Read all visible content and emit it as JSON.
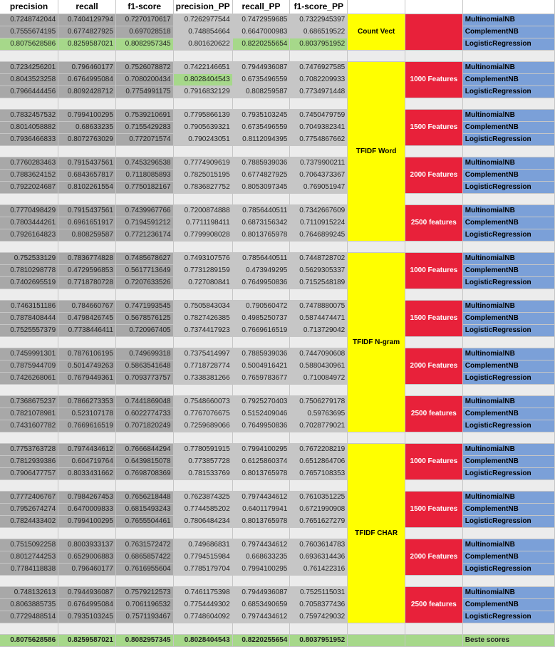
{
  "columns": [
    "precision",
    "recall",
    "f1-score",
    "precision_PP",
    "recall_PP",
    "f1-score_PP"
  ],
  "models": [
    "MultinomialNB",
    "ComplementNB",
    "LogisticRegression"
  ],
  "groups": [
    {
      "section": "Count Vect",
      "label": "",
      "rows": [
        [
          "0.7248742044",
          "0.7404129794",
          "0.7270170617",
          "0.7262977544",
          "0.7472959685",
          "0.7322945397"
        ],
        [
          "0.7555674195",
          "0.6774827925",
          "0.697028518",
          "0.748854664",
          "0.6647000983",
          "0.686519522"
        ],
        [
          "0.8075628586",
          "0.8259587021",
          "0.8082957345",
          "0.801620622",
          "0.8220255654",
          "0.8037951952"
        ]
      ]
    },
    {
      "section": "TFIDF Word",
      "label": "1000 Features",
      "rows": [
        [
          "0.7234256201",
          "0.796460177",
          "0.7526078872",
          "0.7422146651",
          "0.7944936087",
          "0.7476927585"
        ],
        [
          "0.8043523258",
          "0.6764995084",
          "0.7080200434",
          "0.8028404543",
          "0.6735496559",
          "0.7082209933"
        ],
        [
          "0.7966444456",
          "0.8092428712",
          "0.7754991175",
          "0.7916832129",
          "0.808259587",
          "0.7734971448"
        ]
      ]
    },
    {
      "section": "TFIDF Word",
      "label": "1500 Features",
      "rows": [
        [
          "0.7832457532",
          "0.7994100295",
          "0.7539210691",
          "0.7795866139",
          "0.7935103245",
          "0.7450479759"
        ],
        [
          "0.8014058882",
          "0.68633235",
          "0.7155429283",
          "0.7905639321",
          "0.6735496559",
          "0.7049382341"
        ],
        [
          "0.7936466833",
          "0.8072763029",
          "0.772071574",
          "0.790243051",
          "0.8112094395",
          "0.7754867662"
        ]
      ]
    },
    {
      "section": "TFIDF Word",
      "label": "2000 Features",
      "rows": [
        [
          "0.7760283463",
          "0.7915437561",
          "0.7453296538",
          "0.7774909619",
          "0.7885939036",
          "0.7379900211"
        ],
        [
          "0.7883624152",
          "0.6843657817",
          "0.7118085893",
          "0.7825015195",
          "0.6774827925",
          "0.7064373367"
        ],
        [
          "0.7922024687",
          "0.8102261554",
          "0.7750182167",
          "0.7836827752",
          "0.8053097345",
          "0.769051947"
        ]
      ]
    },
    {
      "section": "TFIDF Word",
      "label": "2500 features",
      "rows": [
        [
          "0.7770498429",
          "0.7915437561",
          "0.7439967766",
          "0.7200874888",
          "0.7856440511",
          "0.7342667609"
        ],
        [
          "0.7803444261",
          "0.6961651917",
          "0.7194591212",
          "0.7711198411",
          "0.6873156342",
          "0.7110915224"
        ],
        [
          "0.7926164823",
          "0.808259587",
          "0.7721236174",
          "0.7799908028",
          "0.8013765978",
          "0.7646899245"
        ]
      ]
    },
    {
      "section": "TFIDF N-gram",
      "label": "1000 Features",
      "rows": [
        [
          "0.752533129",
          "0.7836774828",
          "0.7485678627",
          "0.7493107576",
          "0.7856440511",
          "0.7448728702"
        ],
        [
          "0.7810298778",
          "0.4729596853",
          "0.5617713649",
          "0.7731289159",
          "0.473949295",
          "0.5629305337"
        ],
        [
          "0.7402695519",
          "0.7718780728",
          "0.7207633526",
          "0.727080841",
          "0.7649950836",
          "0.7152548189"
        ]
      ]
    },
    {
      "section": "TFIDF N-gram",
      "label": "1500 Features",
      "rows": [
        [
          "0.7463151186",
          "0.784660767",
          "0.7471993545",
          "0.7505843034",
          "0.790560472",
          "0.7478880075"
        ],
        [
          "0.7878408444",
          "0.4798426745",
          "0.5678576125",
          "0.7827426385",
          "0.4985250737",
          "0.5874474471"
        ],
        [
          "0.7525557379",
          "0.7738446411",
          "0.720967405",
          "0.7374417923",
          "0.7669616519",
          "0.713729042"
        ]
      ]
    },
    {
      "section": "TFIDF N-gram",
      "label": "2000 Features",
      "rows": [
        [
          "0.7459991301",
          "0.7876106195",
          "0.749699318",
          "0.7375414997",
          "0.7885939036",
          "0.7447090608"
        ],
        [
          "0.7875944709",
          "0.5014749263",
          "0.5863541648",
          "0.7718728774",
          "0.5004916421",
          "0.5880430961"
        ],
        [
          "0.7426268061",
          "0.7679449361",
          "0.7093773757",
          "0.7338381266",
          "0.7659783677",
          "0.710084972"
        ]
      ]
    },
    {
      "section": "TFIDF N-gram",
      "label": "2500 features",
      "rows": [
        [
          "0.7368675237",
          "0.7866273353",
          "0.7441869048",
          "0.7548660073",
          "0.7925270403",
          "0.7506279178"
        ],
        [
          "0.7821078981",
          "0.523107178",
          "0.6022774733",
          "0.7767076675",
          "0.5152409046",
          "0.59763695"
        ],
        [
          "0.7431607782",
          "0.7669616519",
          "0.7071820249",
          "0.7259689066",
          "0.7649950836",
          "0.7028779021"
        ]
      ]
    },
    {
      "section": "TFIDF CHAR",
      "label": "1000 Features",
      "rows": [
        [
          "0.7753763728",
          "0.7974434612",
          "0.7666844294",
          "0.7780591915",
          "0.7994100295",
          "0.7672208219"
        ],
        [
          "0.7812939386",
          "0.604719764",
          "0.6439815078",
          "0.773857728",
          "0.6125860374",
          "0.6512864706"
        ],
        [
          "0.7906477757",
          "0.8033431662",
          "0.7698708369",
          "0.781533769",
          "0.8013765978",
          "0.7657108353"
        ]
      ]
    },
    {
      "section": "TFIDF CHAR",
      "label": "1500 Features",
      "rows": [
        [
          "0.7772406767",
          "0.7984267453",
          "0.7656218448",
          "0.7623874325",
          "0.7974434612",
          "0.7610351225"
        ],
        [
          "0.7952674274",
          "0.6470009833",
          "0.6815493243",
          "0.7744585202",
          "0.6401179941",
          "0.6721990908"
        ],
        [
          "0.7824433402",
          "0.7994100295",
          "0.7655504461",
          "0.7806484234",
          "0.8013765978",
          "0.7651627279"
        ]
      ]
    },
    {
      "section": "TFIDF CHAR",
      "label": "2000 Features",
      "rows": [
        [
          "0.7515092258",
          "0.8003933137",
          "0.7631572472",
          "0.749686831",
          "0.7974434612",
          "0.7603614783"
        ],
        [
          "0.8012744253",
          "0.6529006883",
          "0.6865857422",
          "0.7794515984",
          "0.668633235",
          "0.6936314436"
        ],
        [
          "0.7784118838",
          "0.796460177",
          "0.7616955604",
          "0.7785179704",
          "0.7994100295",
          "0.761422316"
        ]
      ]
    },
    {
      "section": "TFIDF CHAR",
      "label": "2500 features",
      "rows": [
        [
          "0.748132613",
          "0.7944936087",
          "0.7579212573",
          "0.7461175398",
          "0.7944936087",
          "0.7525115031"
        ],
        [
          "0.8063885735",
          "0.6764995084",
          "0.7061196532",
          "0.7754449302",
          "0.6853490659",
          "0.7058377436"
        ],
        [
          "0.7729488514",
          "0.7935103245",
          "0.7571193467",
          "0.7748604092",
          "0.7974434612",
          "0.7597429032"
        ]
      ]
    }
  ],
  "best": {
    "values": [
      "0.8075628586",
      "0.8259587021",
      "0.8082957345",
      "0.8028404543",
      "0.8220255654",
      "0.8037951952"
    ],
    "label": "Beste scores"
  },
  "colors": {
    "section": "#ffff00",
    "feature": "#e8213a",
    "model": "#7ba0d8",
    "best": "#a6d88a",
    "cell_dark": "#a8a8a8",
    "cell_mid": "#c6c6c6",
    "gap": "#ececec"
  }
}
